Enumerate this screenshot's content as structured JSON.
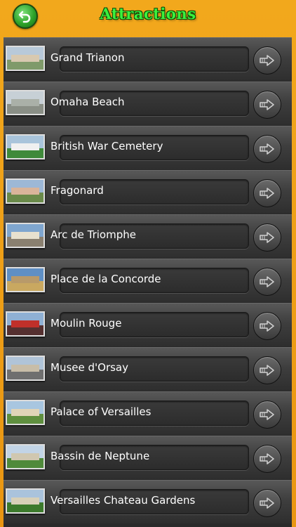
{
  "header": {
    "title": "Attractions",
    "back_icon": "back-arrow-icon"
  },
  "colors": {
    "background": "#f0a41a",
    "title": "#3cf03c",
    "row": "#3e3e3e",
    "label_text": "#ffffff"
  },
  "attractions": [
    {
      "name": "Grand Trianon",
      "sky": "#b8c9d9",
      "ground": "#7f9a6a",
      "bld": "#d8c9b0"
    },
    {
      "name": "Omaha Beach",
      "sky": "#c7d0d6",
      "ground": "#8a8f86",
      "bld": "#aab0a8"
    },
    {
      "name": "British War Cemetery",
      "sky": "#a9c4db",
      "ground": "#3f8a3a",
      "bld": "#f0f0f0"
    },
    {
      "name": "Fragonard",
      "sky": "#9db8d6",
      "ground": "#6a8a4a",
      "bld": "#d9b49a"
    },
    {
      "name": "Arc de Triomphe",
      "sky": "#7fa6cf",
      "ground": "#8a8070",
      "bld": "#e8e1cf"
    },
    {
      "name": "Place de la Concorde",
      "sky": "#5f8fc4",
      "ground": "#c9a860",
      "bld": "#b89a6a"
    },
    {
      "name": "Moulin Rouge",
      "sky": "#8fb0d4",
      "ground": "#553030",
      "bld": "#c0302a"
    },
    {
      "name": "Musee d'Orsay",
      "sky": "#b0c4d8",
      "ground": "#6f6f6f",
      "bld": "#c8bda8"
    },
    {
      "name": "Palace of Versailles",
      "sky": "#a8c6e0",
      "ground": "#5f8f3f",
      "bld": "#e0d4b8"
    },
    {
      "name": "Bassin de Neptune",
      "sky": "#c2d4e6",
      "ground": "#4f8a3a",
      "bld": "#d0c7b0"
    },
    {
      "name": "Versailles Chateau Gardens",
      "sky": "#aac3dc",
      "ground": "#3c7a2c",
      "bld": "#d8d0b8"
    }
  ]
}
